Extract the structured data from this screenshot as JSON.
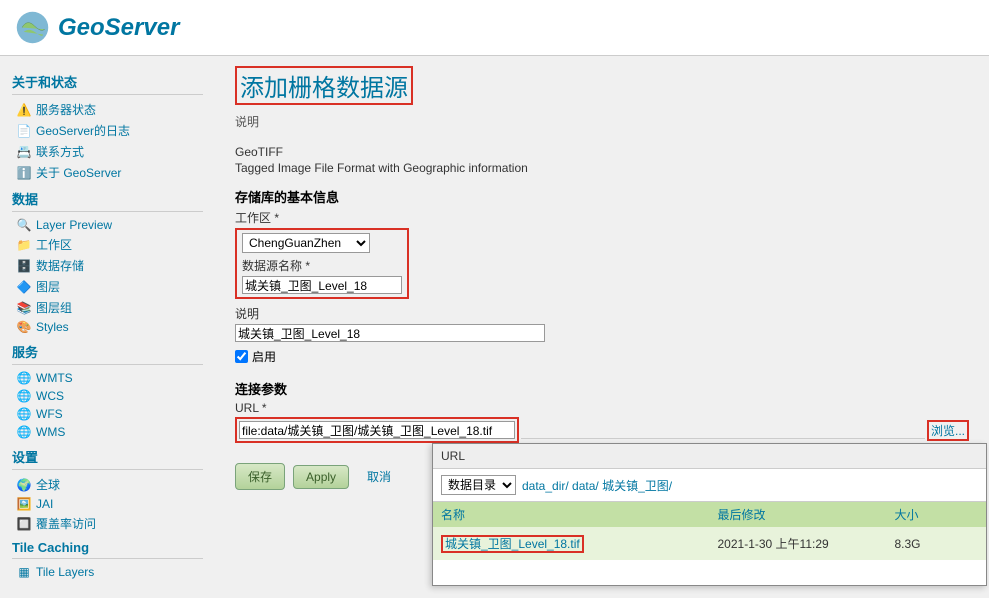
{
  "brand": "GeoServer",
  "page_title": "添加栅格数据源",
  "desc_label": "说明",
  "format_name": "GeoTIFF",
  "format_desc": "Tagged Image File Format with Geographic information",
  "section_basic": "存储库的基本信息",
  "workspace_label": "工作区 *",
  "workspace_value": "ChengGuanZhen",
  "dsname_label": "数据源名称 *",
  "dsname_value": "城关镇_卫图_Level_18",
  "desc2_label": "说明",
  "desc2_value": "城关镇_卫图_Level_18",
  "enable_label": "启用",
  "conn_section": "连接参数",
  "url_label": "URL *",
  "url_value": "file:data/城关镇_卫图/城关镇_卫图_Level_18.tif",
  "browse_label": "浏览...",
  "save_btn": "保存",
  "apply_btn": "Apply",
  "cancel_btn": "取消",
  "sidebar": {
    "about": {
      "title": "关于和状态",
      "items": [
        "服务器状态",
        "GeoServer的日志",
        "联系方式",
        "关于 GeoServer"
      ]
    },
    "data": {
      "title": "数据",
      "items": [
        "Layer Preview",
        "工作区",
        "数据存储",
        "图层",
        "图层组",
        "Styles"
      ]
    },
    "services": {
      "title": "服务",
      "items": [
        "WMTS",
        "WCS",
        "WFS",
        "WMS"
      ]
    },
    "settings": {
      "title": "设置",
      "items": [
        "全球",
        "JAI",
        "覆盖率访问"
      ]
    },
    "tilecache": {
      "title": "Tile Caching",
      "items": [
        "Tile Layers"
      ]
    }
  },
  "popup": {
    "title": "URL",
    "dir_select": "数据目录",
    "crumbs": [
      "data_dir/",
      "data/",
      "城关镇_卫图/"
    ],
    "cols": [
      "名称",
      "最后修改",
      "大小"
    ],
    "row": {
      "name": "城关镇_卫图_Level_18.tif",
      "mtime": "2021-1-30 上午11:29",
      "size": "8.3G"
    }
  }
}
